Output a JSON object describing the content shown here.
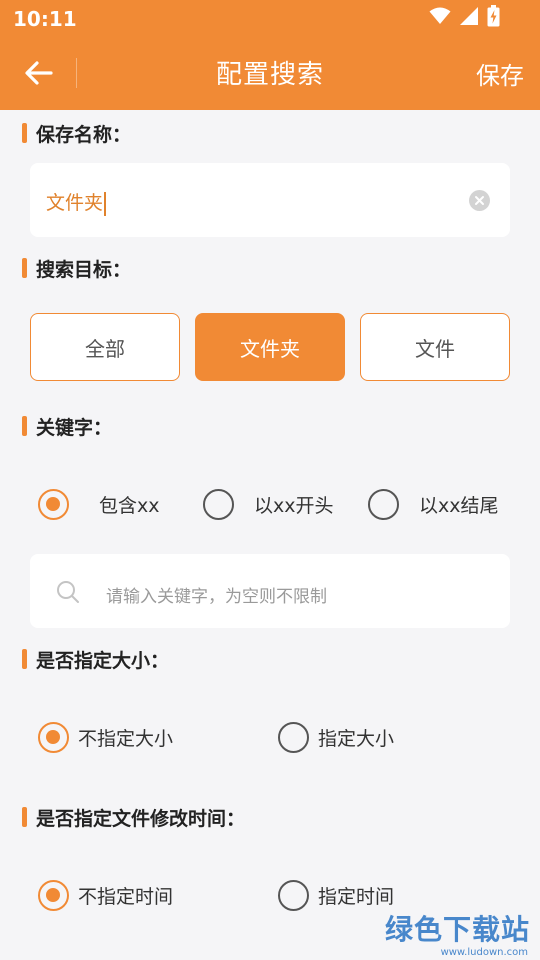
{
  "status_bar": {
    "time": "10:11",
    "icons": [
      "wifi-icon",
      "signal-icon",
      "battery-charging-icon"
    ]
  },
  "toolbar": {
    "title": "配置搜索",
    "save_label": "保存",
    "back_icon": "arrow-left-icon"
  },
  "save_name": {
    "label": "保存名称：",
    "value": "文件夹",
    "clear_icon": "clear-circle-icon"
  },
  "search_target": {
    "label": "搜索目标：",
    "options": [
      "全部",
      "文件夹",
      "文件"
    ],
    "selected": "文件夹"
  },
  "keyword": {
    "label": "关键字：",
    "options": [
      "包含xx",
      "以xx开头",
      "以xx结尾"
    ],
    "selected": "包含xx",
    "placeholder": "请输入关键字，为空则不限制"
  },
  "size": {
    "label": "是否指定大小：",
    "options": [
      "不指定大小",
      "指定大小"
    ],
    "selected": "不指定大小"
  },
  "modify_time": {
    "label": "是否指定文件修改时间：",
    "options": [
      "不指定时间",
      "指定时间"
    ],
    "selected": "不指定时间"
  },
  "watermark": {
    "text": "绿色下载站",
    "url": "www.ludown.com"
  },
  "colors": {
    "accent": "#f18a35",
    "background": "#f5f5f7"
  }
}
